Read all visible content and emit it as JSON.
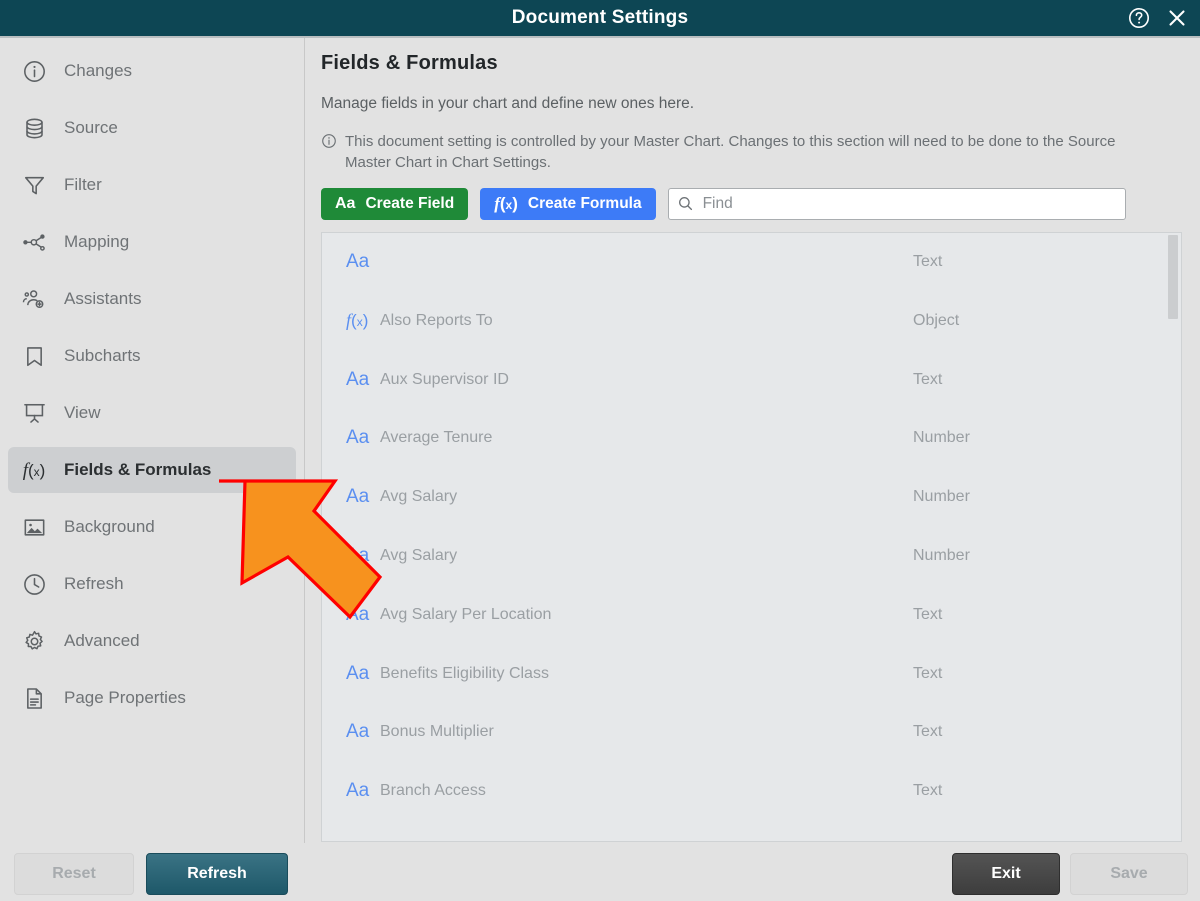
{
  "window": {
    "title": "Document Settings",
    "help_icon": "question-circle-icon",
    "close_icon": "close-icon"
  },
  "sidebar": {
    "items": [
      {
        "label": "Changes",
        "icon": "info-circle-icon",
        "selected": false
      },
      {
        "label": "Source",
        "icon": "database-icon",
        "selected": false
      },
      {
        "label": "Filter",
        "icon": "funnel-icon",
        "selected": false
      },
      {
        "label": "Mapping",
        "icon": "nodes-icon",
        "selected": false
      },
      {
        "label": "Assistants",
        "icon": "users-add-icon",
        "selected": false
      },
      {
        "label": "Subcharts",
        "icon": "bookmark-icon",
        "selected": false
      },
      {
        "label": "View",
        "icon": "presentation-icon",
        "selected": false
      },
      {
        "label": "Fields & Formulas",
        "icon": "fx-icon",
        "selected": true
      },
      {
        "label": "Background",
        "icon": "image-icon",
        "selected": false
      },
      {
        "label": "Refresh",
        "icon": "clock-icon",
        "selected": false
      },
      {
        "label": "Advanced",
        "icon": "gear-icon",
        "selected": false
      },
      {
        "label": "Page Properties",
        "icon": "document-icon",
        "selected": false
      }
    ]
  },
  "main": {
    "heading": "Fields & Formulas",
    "subtitle": "Manage fields in your chart and define new ones here.",
    "notice": {
      "icon": "info-circle-icon",
      "text": "This document setting is controlled by your Master Chart. Changes to this section will need to be done to the Source Master Chart in Chart Settings."
    },
    "toolbar": {
      "create_field_label": "Create Field",
      "create_field_icon": "aa-text-icon",
      "create_formula_label": "Create Formula",
      "create_formula_icon": "fx-icon",
      "search_placeholder": "Find",
      "search_value": "",
      "search_icon": "search-icon"
    },
    "field_list": {
      "rows": [
        {
          "icon": "aa-text-icon",
          "name": "",
          "type": "Text"
        },
        {
          "icon": "fx-icon",
          "name": "Also Reports To",
          "type": "Object"
        },
        {
          "icon": "aa-text-icon",
          "name": "Aux Supervisor ID",
          "type": "Text"
        },
        {
          "icon": "aa-text-icon",
          "name": "Average Tenure",
          "type": "Number"
        },
        {
          "icon": "aa-text-icon",
          "name": "Avg Salary",
          "type": "Number"
        },
        {
          "icon": "aa-text-icon",
          "name": "Avg Salary",
          "type": "Number"
        },
        {
          "icon": "aa-text-icon",
          "name": "Avg Salary Per Location",
          "type": "Text"
        },
        {
          "icon": "aa-text-icon",
          "name": "Benefits Eligibility Class",
          "type": "Text"
        },
        {
          "icon": "aa-text-icon",
          "name": "Bonus Multiplier",
          "type": "Text"
        },
        {
          "icon": "aa-text-icon",
          "name": "Branch Access",
          "type": "Text"
        },
        {
          "icon": "aa-text-icon",
          "name": "",
          "type": ""
        }
      ]
    }
  },
  "footer": {
    "reset_label": "Reset",
    "refresh_label": "Refresh",
    "exit_label": "Exit",
    "save_label": "Save"
  },
  "annotation": {
    "type": "arrow",
    "fill_color": "#F7921E",
    "stroke_color": "#FF0000",
    "points_to": "sidebar-item-fields-formulas"
  },
  "colors": {
    "titlebar": "#0d4654",
    "body_background": "#e2e2e2",
    "selected_nav": "#cdcfd1",
    "create_field_green": "#1f8a38",
    "create_formula_blue": "#3d7bf7",
    "field_icon_blue": "#5b8ff0",
    "refresh_teal": "#1e5869",
    "exit_dark": "#3d3d3d"
  }
}
